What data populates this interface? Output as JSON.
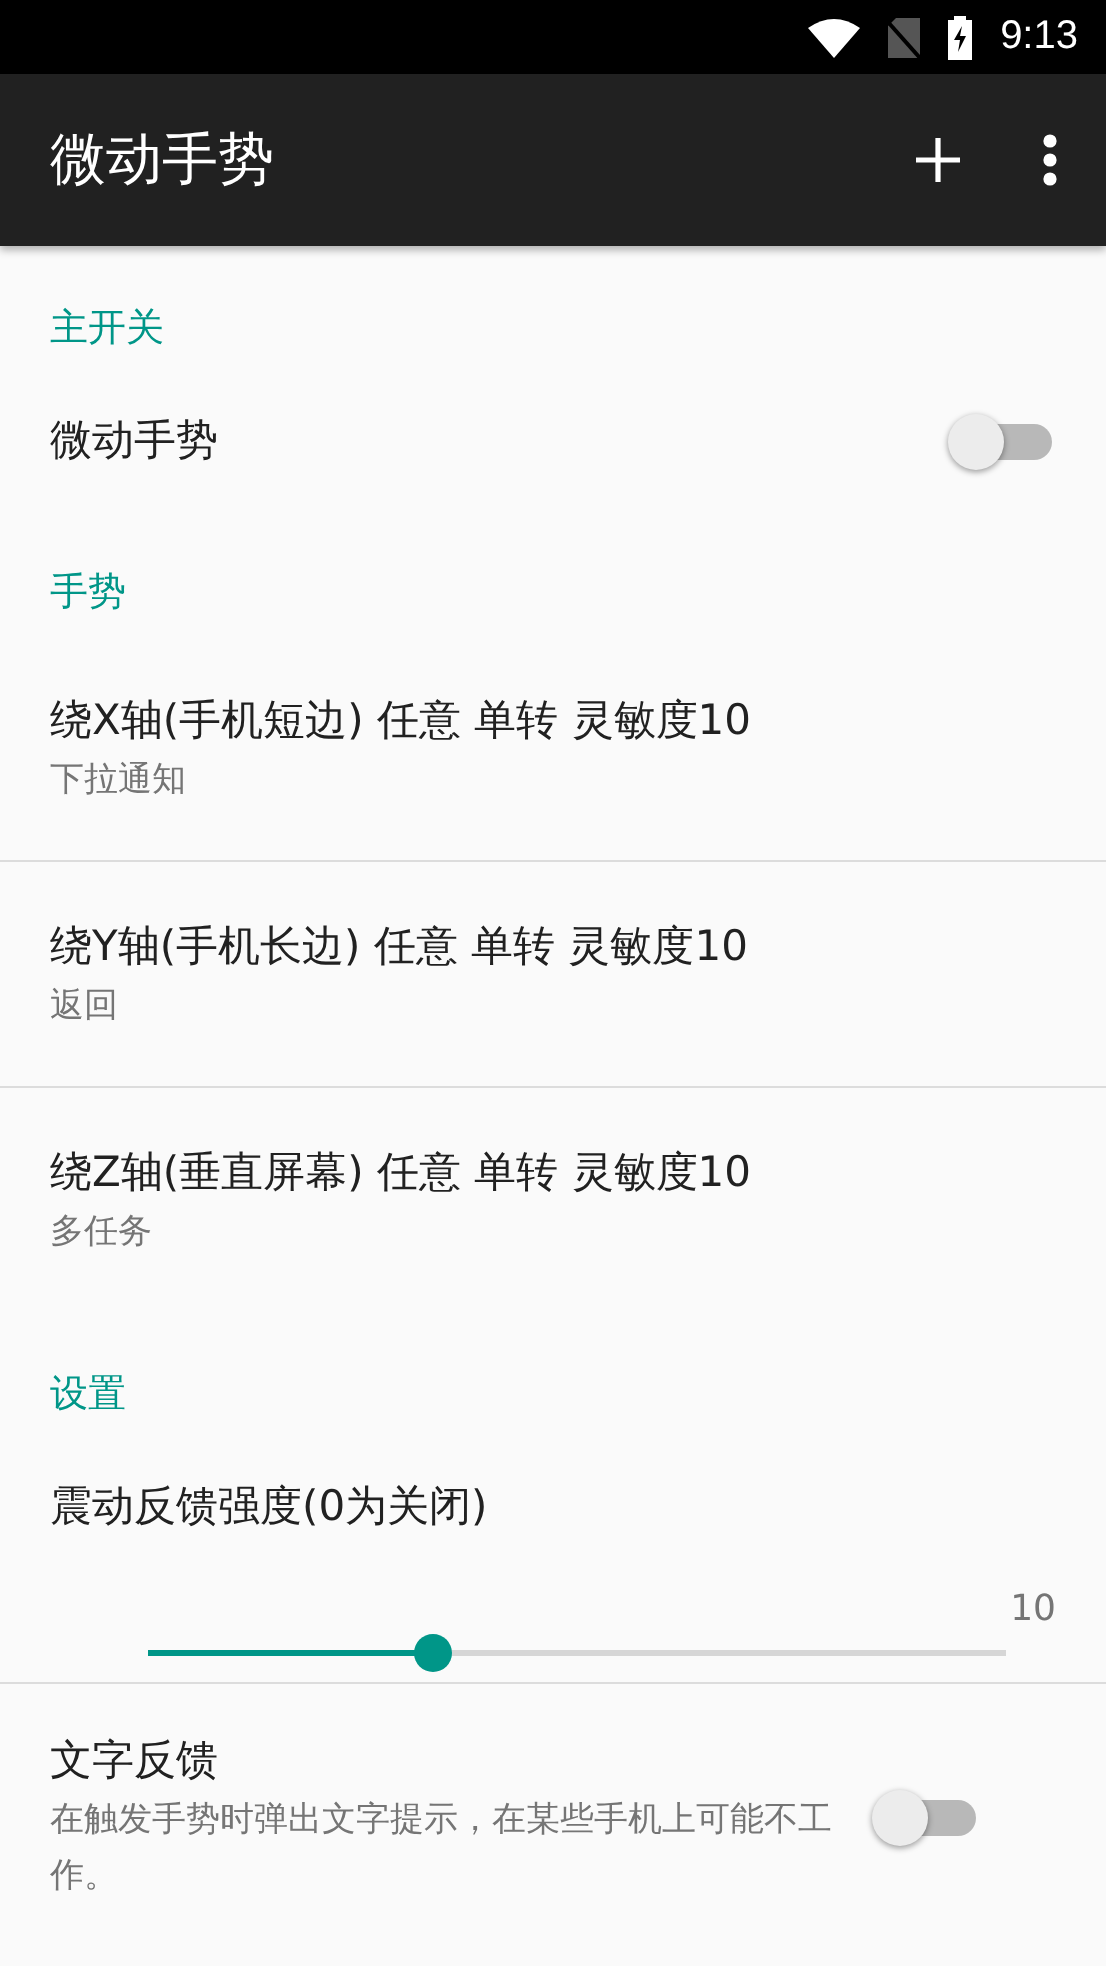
{
  "status_bar": {
    "time": "9:13"
  },
  "app_bar": {
    "title": "微动手势"
  },
  "items": [
    {
      "kind": "header",
      "title": "主开关"
    },
    {
      "kind": "switch",
      "title": "微动手势",
      "on": false
    },
    {
      "kind": "header",
      "title": "手势"
    },
    {
      "kind": "item",
      "title": "绕X轴(手机短边) 任意 单转 灵敏度10",
      "summary": "下拉通知"
    },
    {
      "kind": "item",
      "title": "绕Y轴(手机长边) 任意 单转 灵敏度10",
      "summary": "返回"
    },
    {
      "kind": "item",
      "title": "绕Z轴(垂直屏幕) 任意 单转 灵敏度10",
      "summary": "多任务"
    },
    {
      "kind": "header",
      "title": "设置"
    },
    {
      "kind": "slider",
      "title": "震动反馈强度(0为关闭)",
      "value": "10",
      "level": 0.33
    },
    {
      "kind": "switch",
      "title": "文字反馈",
      "summary": "在触发手势时弹出文字提示，在某些手机上可能不工作。",
      "on": false
    }
  ]
}
